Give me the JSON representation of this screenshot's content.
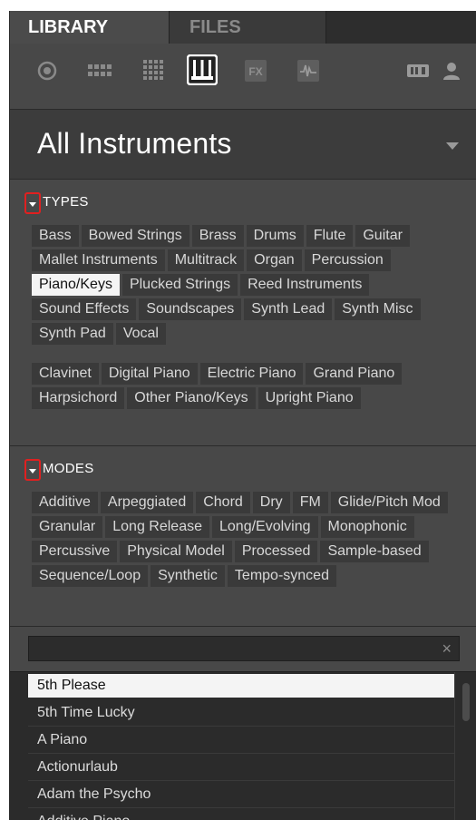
{
  "tabs": {
    "library": "LIBRARY",
    "files": "FILES"
  },
  "toolbar": {
    "icons": [
      "group-icon",
      "sounds-icon",
      "patterns-icon",
      "instruments-icon",
      "effects-icon",
      "samples-icon",
      "user-content-icon",
      "user-icon"
    ],
    "fx_label": "FX",
    "selected": "instruments-icon"
  },
  "header": {
    "title": "All Instruments"
  },
  "types": {
    "label": "TYPES",
    "tags": [
      "Bass",
      "Bowed Strings",
      "Brass",
      "Drums",
      "Flute",
      "Guitar",
      "Mallet Instruments",
      "Multitrack",
      "Organ",
      "Percussion",
      "Piano/Keys",
      "Plucked Strings",
      "Reed Instruments",
      "Sound Effects",
      "Soundscapes",
      "Synth Lead",
      "Synth Misc",
      "Synth Pad",
      "Vocal"
    ],
    "selected": "Piano/Keys",
    "subtypes": [
      "Clavinet",
      "Digital Piano",
      "Electric Piano",
      "Grand Piano",
      "Harpsichord",
      "Other Piano/Keys",
      "Upright Piano"
    ]
  },
  "modes": {
    "label": "MODES",
    "tags": [
      "Additive",
      "Arpeggiated",
      "Chord",
      "Dry",
      "FM",
      "Glide/Pitch Mod",
      "Granular",
      "Long Release",
      "Long/Evolving",
      "Monophonic",
      "Percussive",
      "Physical Model",
      "Processed",
      "Sample-based",
      "Sequence/Loop",
      "Synthetic",
      "Tempo-synced"
    ]
  },
  "search": {
    "value": "",
    "clear": "×"
  },
  "results": [
    "5th Please",
    "5th Time Lucky",
    "A Piano",
    "Actionurlaub",
    "Adam the Psycho",
    "Additive Piano"
  ],
  "selected_result": "5th Please",
  "colors": {
    "accent_red": "#e02020",
    "panel": "#484848",
    "chip": "#3a3a3a",
    "chip_selected": "#f4f4f4"
  }
}
